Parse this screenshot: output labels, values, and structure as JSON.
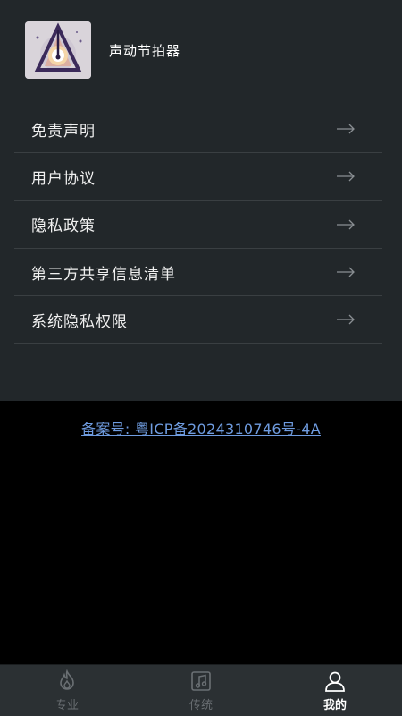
{
  "app": {
    "name": "声动节拍器"
  },
  "menu": {
    "items": [
      {
        "label": "免责声明",
        "icon": "arrow-right-icon"
      },
      {
        "label": "用户协议",
        "icon": "arrow-right-icon"
      },
      {
        "label": "隐私政策",
        "icon": "arrow-right-icon"
      },
      {
        "label": "第三方共享信息清单",
        "icon": "arrow-right-icon"
      },
      {
        "label": "系统隐私权限",
        "icon": "arrow-right-icon"
      }
    ]
  },
  "footer": {
    "icp_text": "备案号: 粤ICP备2024310746号-4A"
  },
  "tabbar": {
    "tabs": [
      {
        "label": "专业",
        "icon": "flame-icon",
        "active": false
      },
      {
        "label": "传统",
        "icon": "music-note-icon",
        "active": false
      },
      {
        "label": "我的",
        "icon": "user-icon",
        "active": true
      }
    ]
  },
  "colors": {
    "panel_bg": "#22272a",
    "page_bg": "#000000",
    "link": "#6f9ce0",
    "tabbar_bg": "#2b3033"
  }
}
